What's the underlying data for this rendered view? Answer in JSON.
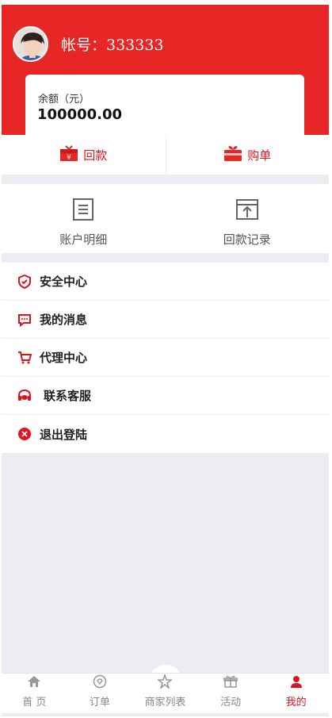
{
  "user": {
    "account_label": "帐号：333333"
  },
  "balance": {
    "label": "余额（元）",
    "value": "100000.00"
  },
  "actions": [
    {
      "label": "回款",
      "icon": "refund-gift-icon"
    },
    {
      "label": "购单",
      "icon": "order-gift-icon"
    }
  ],
  "quick": [
    {
      "label": "账户明细",
      "icon": "document-list-icon"
    },
    {
      "label": "回款记录",
      "icon": "upload-window-icon"
    }
  ],
  "menu": [
    {
      "label": "安全中心",
      "icon": "shield-icon"
    },
    {
      "label": "我的消息",
      "icon": "chat-icon"
    },
    {
      "label": "代理中心",
      "icon": "cart-icon"
    },
    {
      "label": "联系客服",
      "icon": "headset-icon"
    },
    {
      "label": "退出登陆",
      "icon": "close-circle-icon"
    }
  ],
  "tabs": [
    {
      "label": "首 页",
      "icon": "home-icon"
    },
    {
      "label": "订单",
      "icon": "order-icon"
    },
    {
      "label": "商家列表",
      "icon": "star-icon"
    },
    {
      "label": "活动",
      "icon": "gift-icon"
    },
    {
      "label": "我的",
      "icon": "user-icon",
      "active": true
    }
  ],
  "colors": {
    "brand": "#e82626",
    "accent_text": "#d9161e"
  }
}
